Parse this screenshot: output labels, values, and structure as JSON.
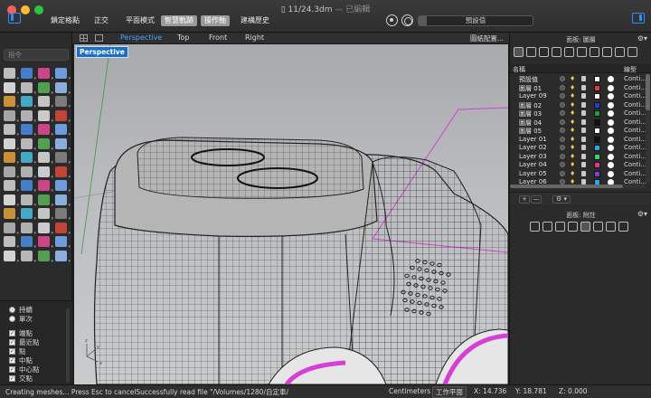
{
  "window": {
    "file_name": "11/24.3dm",
    "edited_label": "— 已編輯"
  },
  "toolbar": {
    "menu": [
      {
        "label": "鎖定格點",
        "active": false
      },
      {
        "label": "正交",
        "active": false
      },
      {
        "label": "平面模式",
        "active": false
      },
      {
        "label": "智慧軌跡",
        "active": true
      },
      {
        "label": "操作軸",
        "active": true
      },
      {
        "label": "建構歷史",
        "active": false
      }
    ],
    "progress_label": "預設值",
    "progress_fraction": 0.07
  },
  "left": {
    "command_placeholder": "指令",
    "tool_icons": [
      "select-arrow",
      "point-cloud",
      "polyline",
      "curve",
      "circle",
      "arc",
      "ellipse",
      "rectangle",
      "curve-control",
      "rebuild-curve",
      "fillet-curve",
      "offset-curve",
      "box",
      "extrude",
      "sphere",
      "cylinder",
      "surface-plane",
      "loft",
      "network-srf",
      "sweep",
      "boolean-union",
      "explode",
      "join",
      "trim",
      "move",
      "rotate",
      "scale",
      "mirror",
      "array",
      "group",
      "ungroup",
      "block",
      "dimension",
      "text",
      "hatch",
      "annotation",
      "analyze-curvature",
      "zebra",
      "draft-angle",
      "environment-map",
      "render",
      "light",
      "camera",
      "named-view",
      "transform-gumball",
      "cage-edit",
      "flow",
      "twist",
      "mesh",
      "mesh-from-nurbs",
      "reduce-mesh",
      "unweld",
      "snapshot",
      "layer-state",
      "rendered-mode",
      "material"
    ],
    "osnap": {
      "radios": [
        {
          "label": "持續",
          "on": true
        },
        {
          "label": "單次",
          "on": false
        }
      ],
      "checks": [
        {
          "label": "端點",
          "on": true
        },
        {
          "label": "最近點",
          "on": true
        },
        {
          "label": "點",
          "on": true
        },
        {
          "label": "中點",
          "on": true
        },
        {
          "label": "中心點",
          "on": true
        },
        {
          "label": "交點",
          "on": true
        }
      ]
    }
  },
  "viewport": {
    "tabs": [
      {
        "label": "Perspective",
        "active": true
      },
      {
        "label": "Top",
        "active": false
      },
      {
        "label": "Front",
        "active": false
      },
      {
        "label": "Right",
        "active": false
      }
    ],
    "settings_label": "圖紙配置...",
    "active_label": "Perspective",
    "axis_x": "x",
    "axis_y": "y",
    "axis_z": "z"
  },
  "layers_panel": {
    "title": "面板: 圖層",
    "col_name": "名稱",
    "col_type": "線型",
    "layers": [
      {
        "name": "預設值",
        "color": "#ffffff",
        "linetype": "Conti...",
        "current": true
      },
      {
        "name": "圖層 01",
        "color": "#e63b2e",
        "linetype": "Conti...",
        "current": false
      },
      {
        "name": "Layer 09",
        "color": "#ffffff",
        "linetype": "Conti...",
        "current": false
      },
      {
        "name": "圖層 02",
        "color": "#1e3fd6",
        "linetype": "Conti...",
        "current": false
      },
      {
        "name": "圖層 03",
        "color": "#1e9e3a",
        "linetype": "Conti...",
        "current": false
      },
      {
        "name": "圖層 04",
        "color": "#111111",
        "linetype": "Conti...",
        "current": false
      },
      {
        "name": "圖層 05",
        "color": "#ffffff",
        "linetype": "Conti...",
        "current": false
      },
      {
        "name": "Layer 01",
        "color": "#111111",
        "linetype": "Conti...",
        "current": false
      },
      {
        "name": "Layer 02",
        "color": "#2aa7e8",
        "linetype": "Conti...",
        "current": false
      },
      {
        "name": "Layer 03",
        "color": "#34d17a",
        "linetype": "Conti...",
        "current": false
      },
      {
        "name": "Layer 04",
        "color": "#e0338f",
        "linetype": "Conti...",
        "current": false
      },
      {
        "name": "Layer 05",
        "color": "#7b3fd6",
        "linetype": "Conti...",
        "current": false
      },
      {
        "name": "Layer 06",
        "color": "#2aa7e8",
        "linetype": "Conti...",
        "current": false
      }
    ],
    "add_label": "+",
    "remove_label": "—",
    "options_label": "⚙ ▾"
  },
  "properties_panel": {
    "title": "面板: 附註"
  },
  "status": {
    "message": "Creating meshes... Press Esc to cancelSuccessfully read file \"/Volumes/1280/自定車/",
    "units": "Centimeters",
    "cplane": "工作平面",
    "x": "X: 14.736",
    "y": "Y: 18.781",
    "z": "Z: 0.000"
  }
}
